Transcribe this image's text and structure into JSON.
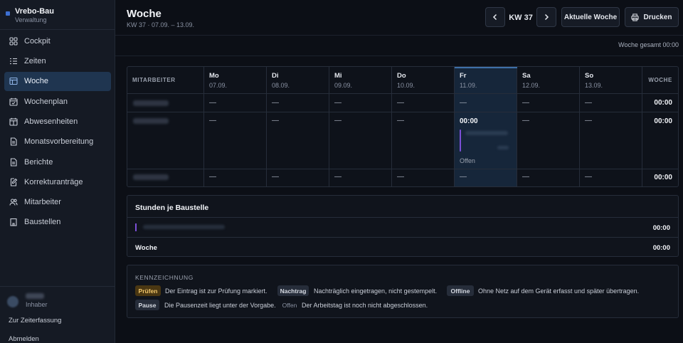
{
  "sidebar": {
    "brand_name": "Vrebo-Bau",
    "brand_sub": "Verwaltung",
    "items": [
      {
        "label": "Cockpit",
        "icon": "grid-icon"
      },
      {
        "label": "Zeiten",
        "icon": "list-icon"
      },
      {
        "label": "Woche",
        "icon": "table-icon",
        "active": true
      },
      {
        "label": "Wochenplan",
        "icon": "calendar-check-icon"
      },
      {
        "label": "Abwesenheiten",
        "icon": "calendar-icon"
      },
      {
        "label": "Monatsvorbereitung",
        "icon": "document-icon"
      },
      {
        "label": "Berichte",
        "icon": "document-icon"
      },
      {
        "label": "Korrekturanträge",
        "icon": "edit-icon"
      },
      {
        "label": "Mitarbeiter",
        "icon": "users-icon"
      },
      {
        "label": "Baustellen",
        "icon": "building-icon"
      }
    ],
    "user_role": "Inhaber",
    "link_zeiterfassung": "Zur Zeiterfassung",
    "link_logout": "Abmelden"
  },
  "header": {
    "title": "Woche",
    "subtitle": "KW 37 · 07.09. – 13.09.",
    "kw": "KW 37",
    "current_week_label": "Aktuelle Woche",
    "print_label": "Drucken",
    "total_line": "Woche gesamt 00:00"
  },
  "week_table": {
    "col_employee": "MITARBEITER",
    "col_week": "WOCHE",
    "days": [
      {
        "day": "Mo",
        "date": "07.09."
      },
      {
        "day": "Di",
        "date": "08.09."
      },
      {
        "day": "Mi",
        "date": "09.09."
      },
      {
        "day": "Do",
        "date": "10.09."
      },
      {
        "day": "Fr",
        "date": "11.09."
      },
      {
        "day": "Sa",
        "date": "12.09."
      },
      {
        "day": "So",
        "date": "13.09."
      }
    ],
    "empty_mark": "—",
    "rows": [
      {
        "week_total": "00:00"
      },
      {
        "week_total": "00:00",
        "friday_time": "00:00",
        "friday_status": "Offen"
      },
      {
        "week_total": "00:00"
      }
    ]
  },
  "sites": {
    "title": "Stunden je Baustelle",
    "rows": [
      {
        "value": "00:00"
      }
    ],
    "week_label": "Woche",
    "week_value": "00:00"
  },
  "legend": {
    "title": "KENNZEICHNUNG",
    "items": [
      {
        "badge": "Prüfen",
        "text": "Der Eintrag ist zur Prüfung markiert."
      },
      {
        "badge": "Nachtrag",
        "text": "Nachträglich eingetragen, nicht gestempelt."
      },
      {
        "badge": "Offline",
        "text": "Ohne Netz auf dem Gerät erfasst und später übertragen."
      },
      {
        "badge": "Pause",
        "text": "Die Pausenzeit liegt unter der Vorgabe."
      },
      {
        "badge": "Offen",
        "text": "Der Arbeitstag ist noch nicht abgeschlossen."
      }
    ]
  },
  "colors": {
    "accent": "#3e6fa8",
    "entry_bar": "#7b4fd6",
    "pruefen_bg": "#4a3712",
    "pruefen_fg": "#f0c56a"
  }
}
